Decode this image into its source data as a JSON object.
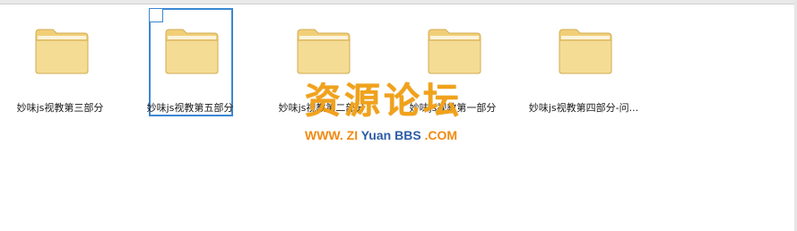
{
  "folders": [
    {
      "name": "妙味js视教第三部分",
      "selected": false
    },
    {
      "name": "妙味js视教第五部分",
      "selected": true
    },
    {
      "name": "妙味js视教第二部分",
      "selected": false
    },
    {
      "name": "妙味js视教第一部分",
      "selected": false
    },
    {
      "name": "妙味js视教第四部分-问...",
      "selected": false
    }
  ],
  "watermark": {
    "title": "资源论坛",
    "sub_prefix": "WWW.",
    "sub_zi": " ZI",
    "sub_yuan": " Yuan",
    "sub_bbs": " BBS",
    "sub_suffix": " .COM"
  },
  "colors": {
    "selection": "#3b87d3",
    "folder_body": "#f5d98a",
    "folder_edge": "#d7b35a",
    "watermark_orange": "#f08a10",
    "watermark_blue": "#2d5da6"
  },
  "icons": [
    "folder-icon"
  ]
}
